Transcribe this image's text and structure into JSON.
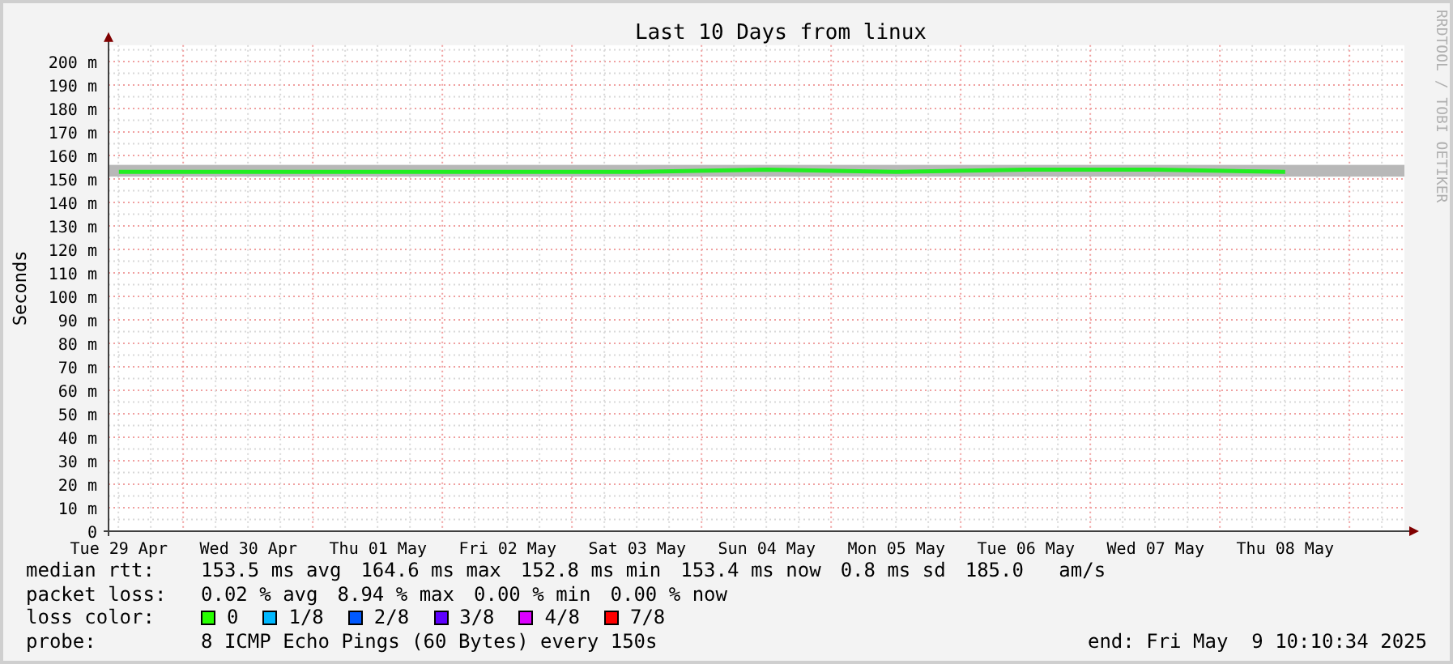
{
  "credit": "RRDTOOL / TOBI OETIKER",
  "chart_data": {
    "type": "line",
    "title": "Last 10 Days from linux",
    "ylabel": "Seconds",
    "ylim": [
      0,
      207
    ],
    "grid": true,
    "bands": [
      {
        "axis": "y",
        "from": 151,
        "to": 156,
        "color": "#b8b8b8"
      }
    ],
    "categories": [
      "Tue 29 Apr",
      "Wed 30 Apr",
      "Thu 01 May",
      "Fri 02 May",
      "Sat 03 May",
      "Sun 04 May",
      "Mon 05 May",
      "Tue 06 May",
      "Wed 07 May",
      "Thu 08 May"
    ],
    "yticks": [
      {
        "value": 0,
        "label": "0"
      },
      {
        "value": 10,
        "label": "10 m"
      },
      {
        "value": 20,
        "label": "20 m"
      },
      {
        "value": 30,
        "label": "30 m"
      },
      {
        "value": 40,
        "label": "40 m"
      },
      {
        "value": 50,
        "label": "50 m"
      },
      {
        "value": 60,
        "label": "60 m"
      },
      {
        "value": 70,
        "label": "70 m"
      },
      {
        "value": 80,
        "label": "80 m"
      },
      {
        "value": 90,
        "label": "90 m"
      },
      {
        "value": 100,
        "label": "100 m"
      },
      {
        "value": 110,
        "label": "110 m"
      },
      {
        "value": 120,
        "label": "120 m"
      },
      {
        "value": 130,
        "label": "130 m"
      },
      {
        "value": 140,
        "label": "140 m"
      },
      {
        "value": 150,
        "label": "150 m"
      },
      {
        "value": 160,
        "label": "160 m"
      },
      {
        "value": 170,
        "label": "170 m"
      },
      {
        "value": 180,
        "label": "180 m"
      },
      {
        "value": 190,
        "label": "190 m"
      },
      {
        "value": 200,
        "label": "200 m"
      }
    ],
    "series": [
      {
        "color": "#22ee22",
        "values": [
          153,
          153,
          153,
          153,
          153,
          154,
          153,
          154,
          154,
          153
        ]
      }
    ]
  },
  "stats": [
    {
      "label": "median rtt:",
      "values": [
        "153.5 ms avg",
        "164.6 ms max",
        "152.8 ms min",
        "153.4 ms now",
        "0.8 ms sd",
        "185.0   am/s"
      ]
    },
    {
      "label": "packet loss:",
      "values": [
        "0.02 % avg",
        "8.94 % max",
        "0.00 % min",
        "0.00 % now"
      ]
    }
  ],
  "loss_color": {
    "label": "loss color:",
    "items": [
      {
        "label": "0",
        "color": "#26ff00"
      },
      {
        "label": "1/8",
        "color": "#00b8ff"
      },
      {
        "label": "2/8",
        "color": "#0059ff"
      },
      {
        "label": "3/8",
        "color": "#5e00ff"
      },
      {
        "label": "4/8",
        "color": "#dd00ff"
      },
      {
        "label": "7/8",
        "color": "#ff0000"
      }
    ]
  },
  "probe": {
    "label": "probe:",
    "value": "8 ICMP Echo Pings (60 Bytes) every 150s"
  },
  "end": "end: Fri May  9 10:10:34 2025"
}
